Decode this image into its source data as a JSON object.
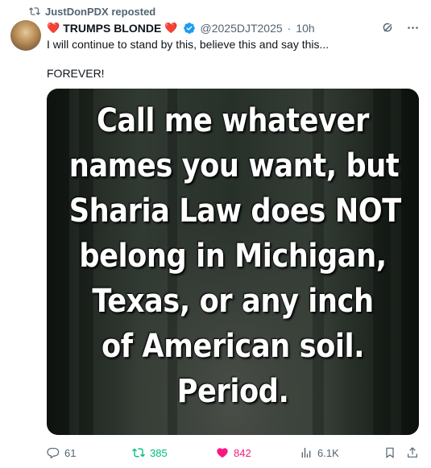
{
  "repost": {
    "label": "JustDonPDX reposted"
  },
  "author": {
    "name": "TRUMPS BLONDE",
    "handle": "@2025DJT2025",
    "separator": "·",
    "time": "10h",
    "heart_glyph": "❤️"
  },
  "post": {
    "line1": "I will continue to stand by this, believe this and say this...",
    "line2": "FOREVER!"
  },
  "media": {
    "lines": [
      "Call me whatever",
      "names you want, but",
      "Sharia Law does NOT",
      "belong in Michigan,",
      "Texas, or any inch",
      "of American soil.",
      "Period."
    ]
  },
  "actions": {
    "replies": "61",
    "reposts": "385",
    "likes": "842",
    "views": "6.1K"
  },
  "colors": {
    "repost_active": "#00ba7c",
    "like_active": "#f91880",
    "verified": "#1d9bf0",
    "muted": "#536471"
  }
}
